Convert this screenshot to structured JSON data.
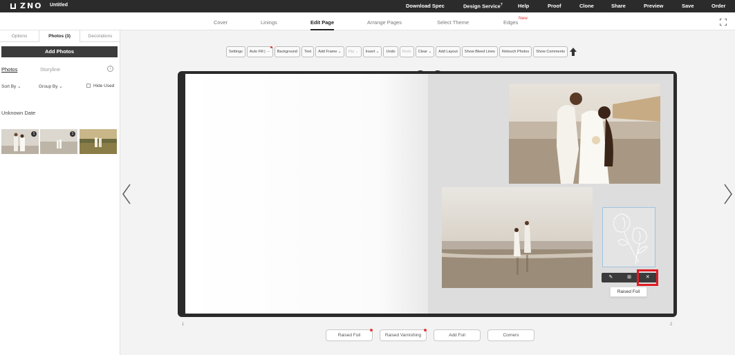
{
  "topbar": {
    "logo": "ZNO",
    "doc_title": "Untitled",
    "nav": [
      "Download Spec",
      "Design Service",
      "Help",
      "Proof",
      "Clone",
      "Share",
      "Preview",
      "Save",
      "Order"
    ],
    "design_service_badge": "?"
  },
  "tabs": {
    "items": [
      "Cover",
      "Linings",
      "Edit Page",
      "Arrange Pages",
      "Select Theme",
      "Edges"
    ],
    "active": "Edit Page",
    "new_badge": "New"
  },
  "left_panel": {
    "tabs": [
      "Options",
      "Photos (3)",
      "Decorations"
    ],
    "active_tab": "Photos (3)",
    "add_photos": "Add Photos",
    "sub_tabs": [
      "Photos",
      "Storyline"
    ],
    "sort_by": "Sort By",
    "group_by": "Group By",
    "hide_used": "Hide Used",
    "section_label": "Unknown Date",
    "thumb_badges": [
      "1",
      "",
      "1"
    ]
  },
  "toolbar": {
    "buttons": [
      "Settings",
      "Auto Fill",
      "Background",
      "Text",
      "Add Frame",
      "Flip",
      "Insert",
      "Undo",
      "Redo",
      "Clear",
      "Add Layout",
      "Show Bleed Lines",
      "Retouch Photos",
      "Show Comments"
    ],
    "disabled": [
      "Flip",
      "Redo"
    ]
  },
  "selection_actions": {
    "edit": "✎",
    "grid": "⊞",
    "delete": "✕",
    "tooltip": "Raised Foil"
  },
  "pages": {
    "left_number": "1",
    "right_number": "2"
  },
  "bottom_bar": {
    "buttons": [
      "Raised Foil",
      "Raised Varnishing",
      "Add Foil",
      "Corners"
    ]
  },
  "colors": {
    "topbar_bg": "#2b2b2b",
    "accent_red": "#e21b23",
    "frame_blue": "#9fc3df"
  }
}
